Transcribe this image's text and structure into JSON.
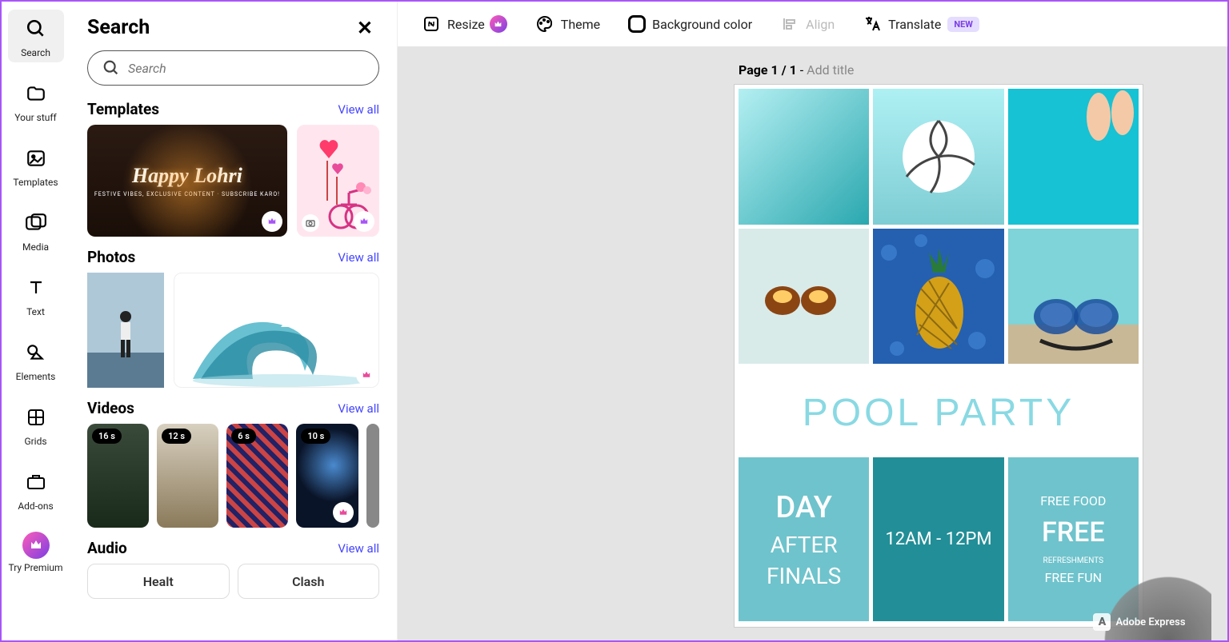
{
  "rail": {
    "items": [
      {
        "label": "Search",
        "name": "search",
        "active": true
      },
      {
        "label": "Your stuff",
        "name": "your-stuff"
      },
      {
        "label": "Templates",
        "name": "templates"
      },
      {
        "label": "Media",
        "name": "media"
      },
      {
        "label": "Text",
        "name": "text"
      },
      {
        "label": "Elements",
        "name": "elements"
      },
      {
        "label": "Grids",
        "name": "grids"
      },
      {
        "label": "Add-ons",
        "name": "addons"
      }
    ],
    "premium_label": "Try Premium"
  },
  "panel": {
    "title": "Search",
    "placeholder": "Search",
    "sections": {
      "templates": {
        "title": "Templates",
        "view_all": "View all",
        "card_title": "Happy Lohri",
        "card_sub": "FESTIVE VIBES, EXCLUSIVE CONTENT · SUBSCRIBE KARO!"
      },
      "photos": {
        "title": "Photos",
        "view_all": "View all"
      },
      "videos": {
        "title": "Videos",
        "view_all": "View all",
        "durations": [
          "16 s",
          "12 s",
          "6 s",
          "10 s",
          ""
        ]
      },
      "audio": {
        "title": "Audio",
        "view_all": "View all",
        "items": [
          "Healt",
          "Clash"
        ]
      }
    }
  },
  "toolbar": {
    "resize": "Resize",
    "theme": "Theme",
    "bgcolor": "Background color",
    "align": "Align",
    "translate": "Translate",
    "new": "NEW"
  },
  "page": {
    "prefix": "Page 1 / 1",
    "sep": " - ",
    "placeholder": "Add title"
  },
  "poster": {
    "banner": "POOL PARTY",
    "col1_line1": "DAY",
    "col1_line2": "AFTER",
    "col1_line3": "FINALS",
    "col2": "12AM - 12PM",
    "col3_line1": "FREE FOOD",
    "col3_line2": "FREE",
    "col3_line3": "REFRESHMENTS",
    "col3_line4": "FREE FUN"
  },
  "watermark": "Adobe Express"
}
